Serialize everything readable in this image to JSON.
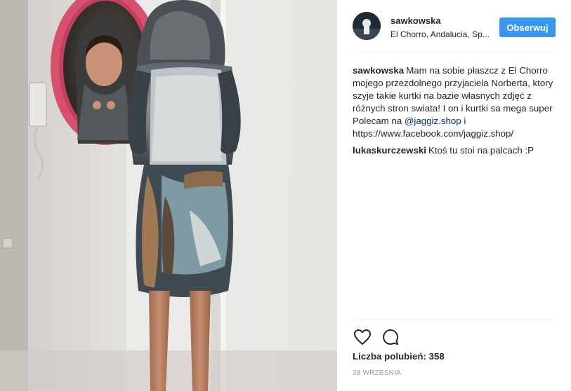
{
  "post": {
    "author": "sawkowska",
    "location": "El Chorro, Andalucia, Sp...",
    "follow_label": "Obserwuj"
  },
  "comments": [
    {
      "user": "sawkowska",
      "text_before": "Mam na sobie płaszcz z El Chorro mojego przezdolnego przyjaciela Norberta, ktory szyje takie kurtki na bazie własnych zdjęć z różnych stron swiata! I on i kurtki sa mega super Polecam na ",
      "mention": "@jaggiz.shop",
      "text_after": " i https://www.facebook.com/jaggiz.shop/"
    },
    {
      "user": "lukaskurczewski",
      "text": "Ktoś tu stoi na palcach :P"
    }
  ],
  "actions": {
    "like_icon": "heart-icon",
    "comment_icon": "comment-icon"
  },
  "likes": {
    "label": "Liczba polubień:",
    "count": "358"
  },
  "date": "28 WRZEŚNIA",
  "colors": {
    "follow_button": "#3897f0",
    "mention_link": "#003569",
    "mirror_frame": "#d8506f"
  }
}
